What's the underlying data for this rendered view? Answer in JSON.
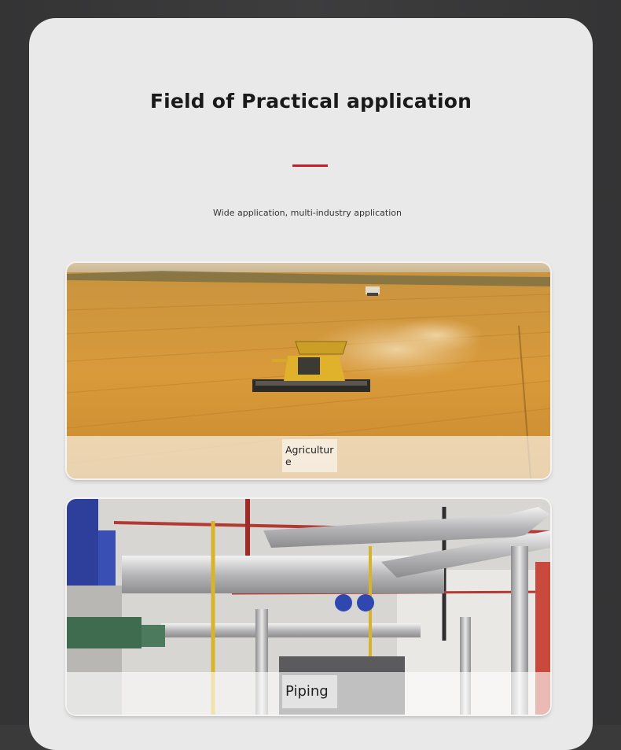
{
  "section": {
    "title": "Field of Practical application",
    "subtitle": "Wide application, multi-industry application"
  },
  "colors": {
    "accent": "#c8202a",
    "card_bg": "#e9e9e9",
    "frame_bg": "#3a3a3b"
  },
  "applications": [
    {
      "label": "Agriculture",
      "image": "combine-harvester-wheat-field"
    },
    {
      "label": "Piping",
      "image": "industrial-insulated-pipes"
    }
  ]
}
